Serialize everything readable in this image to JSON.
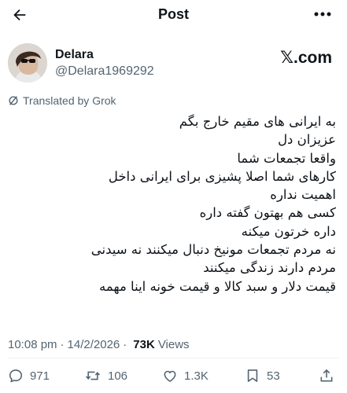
{
  "header": {
    "title": "Post"
  },
  "author": {
    "name": "Delara",
    "handle": "@Delara1969292",
    "source": "𝕏.com"
  },
  "translation_note": "Translated by Grok",
  "post": {
    "lines": [
      "به ایرانی های مقیم خارج بگم",
      "عزیزان دل",
      "واقعا تجمعات شما",
      "کارهای شما اصلا پشیزی برای ایرانی داخل",
      "اهمیت نداره",
      "کسی هم بهتون گفته داره",
      "داره خرتون میکنه",
      "نه مردم تجمعات مونیخ دنبال میکنند نه سیدنی",
      "مردم دارند زندگی میکنند",
      "قیمت دلار و سبد کالا و قیمت خونه اینا مهمه"
    ]
  },
  "meta": {
    "time": "10:08 pm",
    "separator": "·",
    "date": "14/2/2026",
    "views_count": "73K",
    "views_label": "Views"
  },
  "actions": {
    "replies": "971",
    "reposts": "106",
    "likes": "1.3K",
    "bookmarks": "53"
  },
  "icons": {
    "back": "arrow-left-icon",
    "more": "more-horizontal-icon",
    "translate": "grok-icon",
    "reply": "comment-icon",
    "repost": "repost-icon",
    "like": "heart-icon",
    "bookmark": "bookmark-icon",
    "share": "share-icon"
  }
}
